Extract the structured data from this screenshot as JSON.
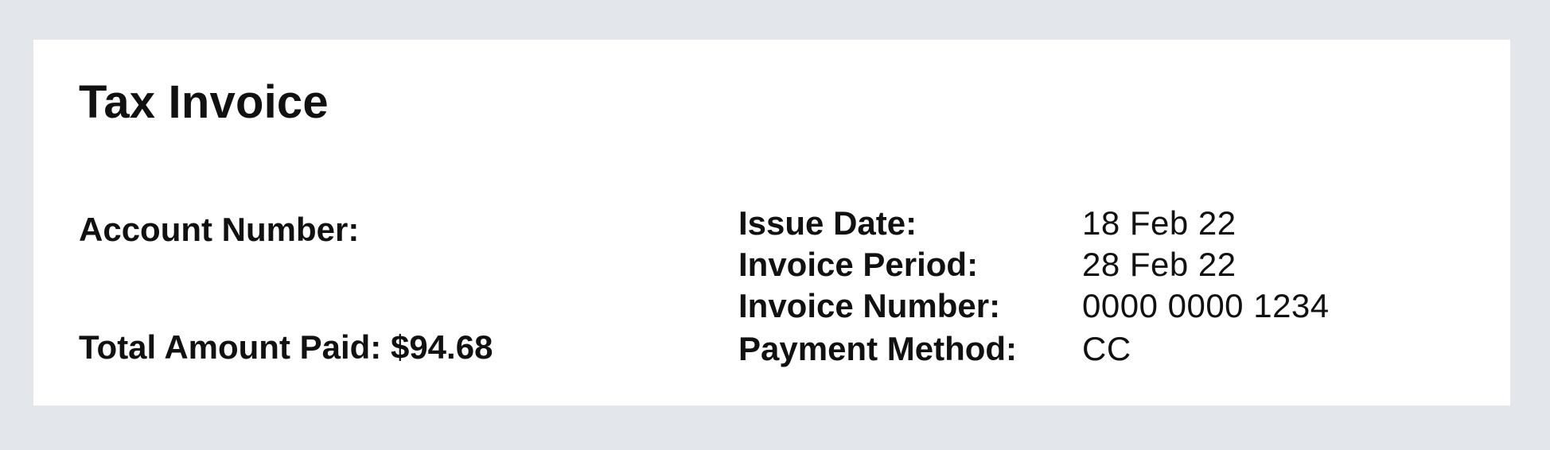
{
  "invoice": {
    "title": "Tax Invoice",
    "account_number_label": "Account Number:",
    "total_paid_text": "Total Amount Paid: $94.68",
    "details": [
      {
        "label": "Issue Date:",
        "value": "18 Feb 22"
      },
      {
        "label": "Invoice Period:",
        "value": "28 Feb 22"
      },
      {
        "label": "Invoice Number:",
        "value": "0000 0000 1234"
      },
      {
        "label": "Payment Method:",
        "value": "CC"
      }
    ]
  },
  "colors": {
    "page_background": "#e3e7eb",
    "card_background": "#ffffff",
    "text": "#111111"
  }
}
